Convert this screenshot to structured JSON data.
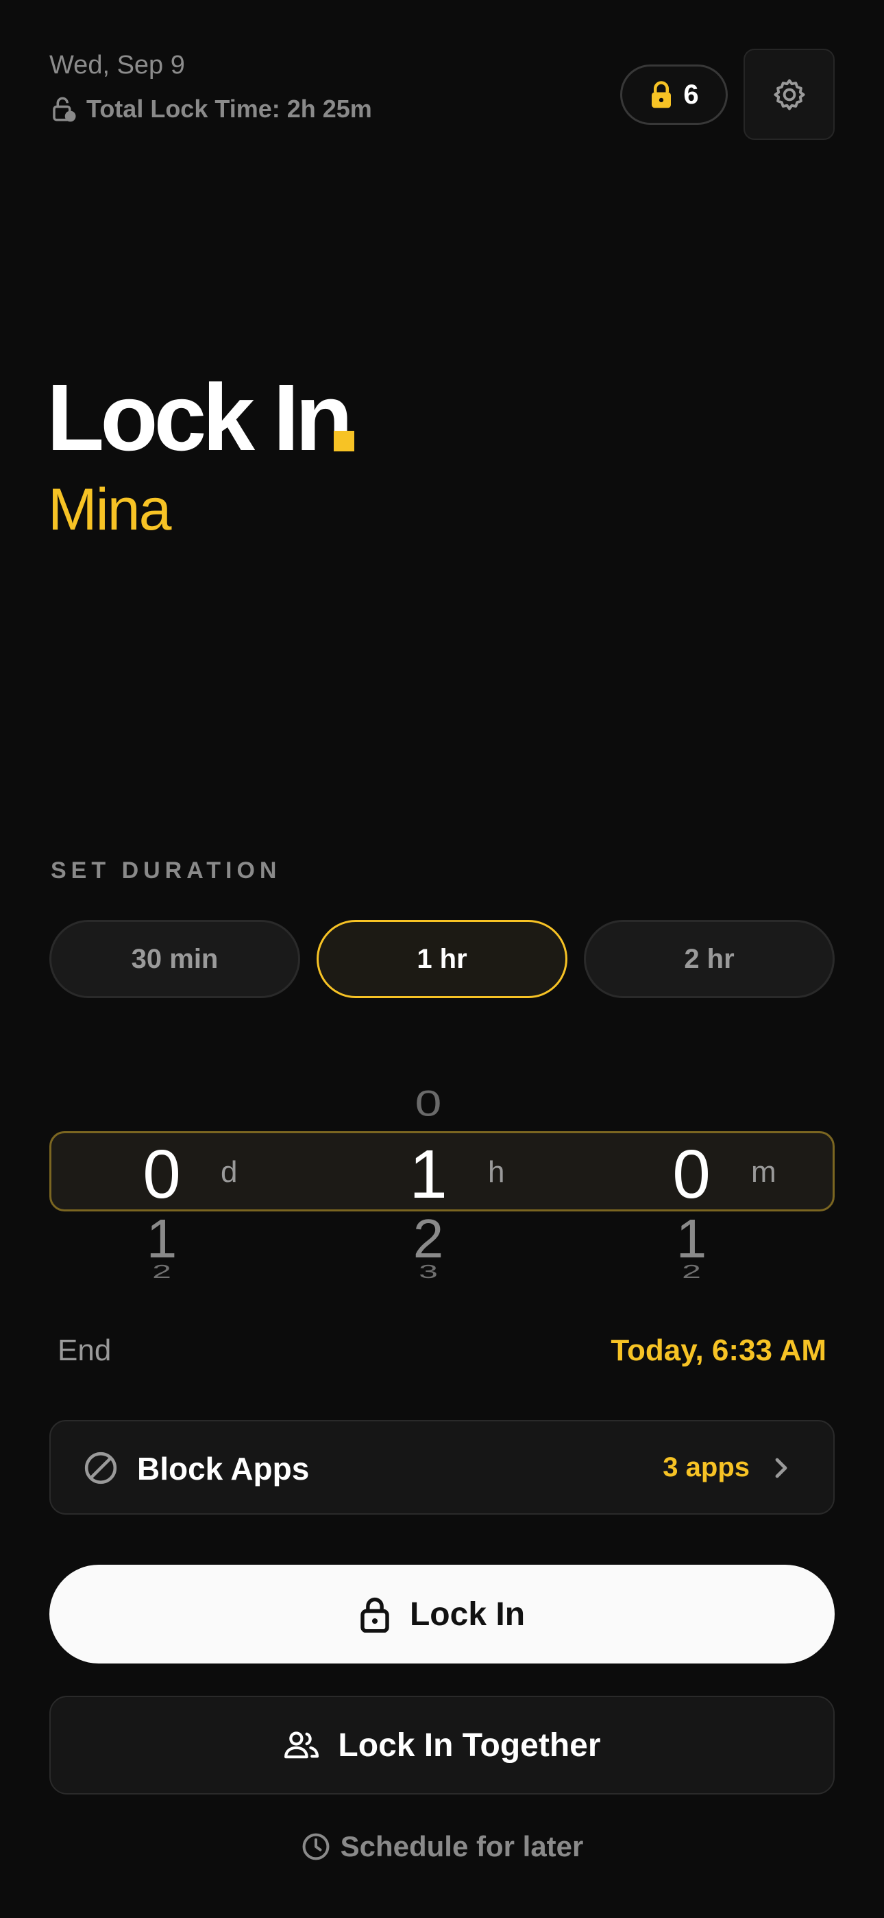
{
  "header": {
    "date": "Wed, Sep 9",
    "total_lock_time": "Total Lock Time: 2h 25m",
    "lock_count": "6"
  },
  "hero": {
    "title": "Lock In",
    "name": "Mina"
  },
  "duration": {
    "section_label": "SET DURATION",
    "presets": [
      "30 min",
      "1 hr",
      "2 hr"
    ],
    "selected_preset": "1 hr",
    "picker": {
      "days": {
        "prev": "",
        "selected": "0",
        "next": [
          "1",
          "2"
        ],
        "unit": "d"
      },
      "hours": {
        "prev": "0",
        "selected": "1",
        "next": [
          "2",
          "3"
        ],
        "unit": "h"
      },
      "minutes": {
        "prev": "",
        "selected": "0",
        "next": [
          "1",
          "2"
        ],
        "unit": "m"
      }
    }
  },
  "end": {
    "label": "End",
    "value": "Today, 6:33 AM"
  },
  "block_apps": {
    "label": "Block Apps",
    "count": "3 apps"
  },
  "actions": {
    "lock_in": "Lock In",
    "lock_in_together": "Lock In Together",
    "schedule_later": "Schedule for later"
  },
  "colors": {
    "accent": "#f7c325",
    "background": "#0c0c0c",
    "surface": "#161616"
  },
  "icons": {
    "lock": "lock-icon",
    "settings": "gear-icon",
    "block": "block-icon",
    "people": "people-icon",
    "clock": "clock-icon",
    "chevron": "chevron-right-icon"
  }
}
